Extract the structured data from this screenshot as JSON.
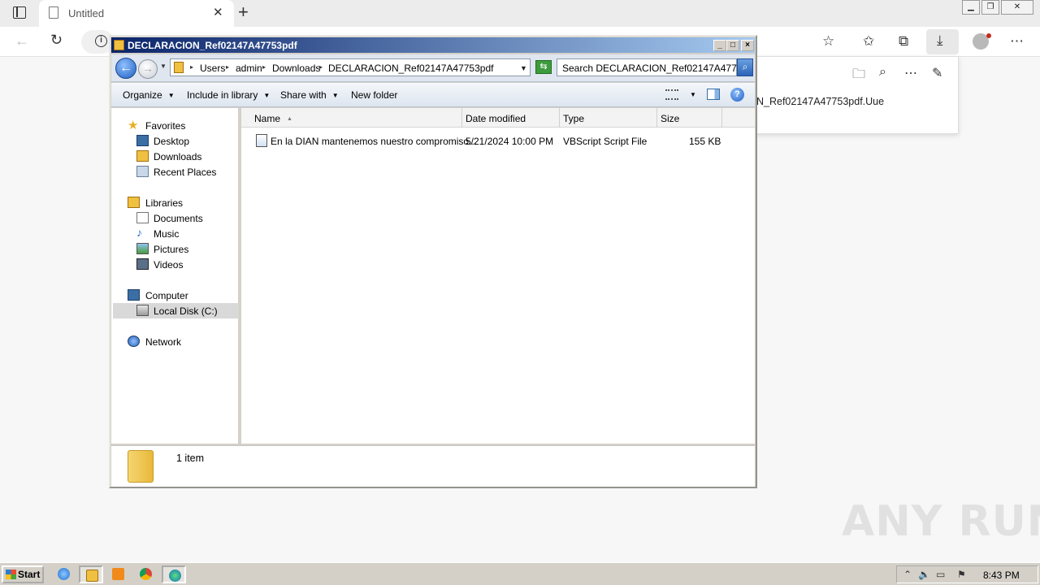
{
  "edge": {
    "tab_title": "Untitled",
    "downloads_panel": {
      "filename_partial": "N_Ref02147A47753pdf.Uue"
    }
  },
  "explorer": {
    "title": "DECLARACION_Ref02147A47753pdf",
    "breadcrumbs": [
      "Users",
      "admin",
      "Downloads",
      "DECLARACION_Ref02147A47753pdf"
    ],
    "search_placeholder": "Search DECLARACION_Ref02147A477...",
    "commands": {
      "organize": "Organize",
      "include_in_library": "Include in library",
      "share_with": "Share with",
      "new_folder": "New folder"
    },
    "nav": {
      "favorites": "Favorites",
      "desktop": "Desktop",
      "downloads": "Downloads",
      "recent_places": "Recent Places",
      "libraries": "Libraries",
      "documents": "Documents",
      "music": "Music",
      "pictures": "Pictures",
      "videos": "Videos",
      "computer": "Computer",
      "local_disk": "Local Disk (C:)",
      "network": "Network"
    },
    "columns": {
      "name": "Name",
      "date_modified": "Date modified",
      "type": "Type",
      "size": "Size"
    },
    "files": [
      {
        "name": "En la DIAN mantenemos nuestro compromiso...",
        "date_modified": "5/21/2024 10:00 PM",
        "type": "VBScript Script File",
        "size": "155 KB"
      }
    ],
    "status": "1 item"
  },
  "taskbar": {
    "start_label": "Start",
    "clock": "8:43 PM"
  },
  "watermark": "ANY RUN",
  "icons": {
    "favorites": "star-icon",
    "back": "back-arrow-icon",
    "search": "search-icon"
  }
}
